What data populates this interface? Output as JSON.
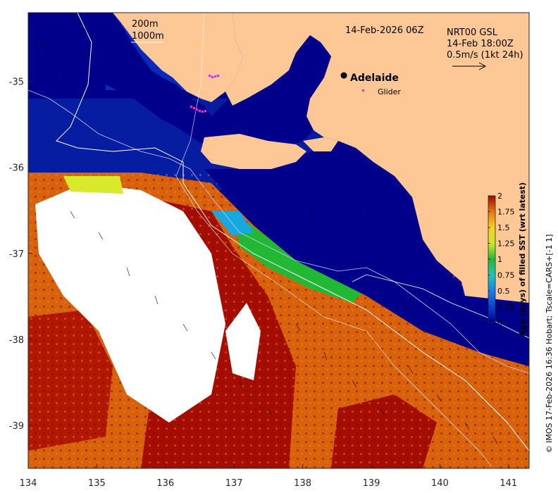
{
  "map": {
    "timestamp": "14-Feb-2026 06Z",
    "bathymetry_legend": [
      "200m",
      "1000m"
    ],
    "current_source": {
      "product": "NRT00 GSL",
      "time": "14-Feb 18:00Z",
      "scale": "0.5m/s (1kt 24h)"
    },
    "city": {
      "name": "Adelaide",
      "lon": 138.6,
      "lat": -34.93
    },
    "glider": {
      "label": "Glider",
      "color": "#d633d6"
    },
    "credit": "© IMOS 17-Feb-2026 16:36 Hobart; Tscale=CARS+[-1 1]",
    "axes": {
      "x_ticks": [
        "134",
        "135",
        "136",
        "137",
        "138",
        "139",
        "140",
        "141"
      ],
      "y_ticks": [
        "-35",
        "-36",
        "-37",
        "-38",
        "-39"
      ],
      "xlim": [
        134,
        141.3
      ],
      "ylim": [
        -39.5,
        -34.2
      ]
    },
    "colors": {
      "land": "#fdc896",
      "ocean_fresh": "#00008b",
      "no_data": "#ffffff"
    },
    "colorbar": {
      "label": "Age (days) of filled SST (wrt latest)",
      "ticks": [
        "2",
        "1.75",
        "1.5",
        "1.25",
        "1",
        "0.75",
        "0.5",
        "0.25",
        "0"
      ],
      "range": [
        0,
        2
      ]
    }
  }
}
